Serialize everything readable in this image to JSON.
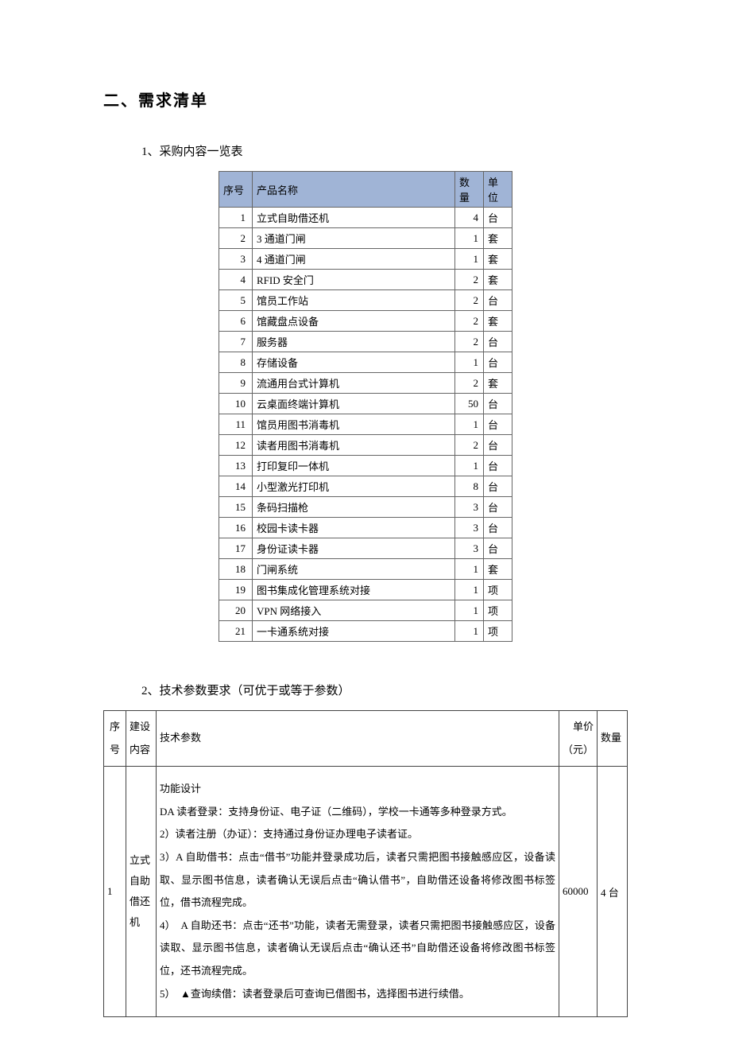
{
  "section_title": "二、需求清单",
  "subsection1_title": "1、采购内容一览表",
  "subsection2_title": "2、技术参数要求（可优于或等于参数）",
  "chart_data": {
    "type": "table",
    "columns": [
      "序号",
      "产品名称",
      "数量",
      "单位"
    ],
    "rows": [
      {
        "seq": "1",
        "name": "立式自助借还机",
        "qty": "4",
        "unit": "台"
      },
      {
        "seq": "2",
        "name": "3 通道门闸",
        "qty": "1",
        "unit": "套"
      },
      {
        "seq": "3",
        "name": "4 通道门闸",
        "qty": "1",
        "unit": "套"
      },
      {
        "seq": "4",
        "name": "RFID 安全门",
        "qty": "2",
        "unit": "套"
      },
      {
        "seq": "5",
        "name": "馆员工作站",
        "qty": "2",
        "unit": "台"
      },
      {
        "seq": "6",
        "name": "馆藏盘点设备",
        "qty": "2",
        "unit": "套"
      },
      {
        "seq": "7",
        "name": "服务器",
        "qty": "2",
        "unit": "台"
      },
      {
        "seq": "8",
        "name": "存储设备",
        "qty": "1",
        "unit": "台"
      },
      {
        "seq": "9",
        "name": "流通用台式计算机",
        "qty": "2",
        "unit": "套"
      },
      {
        "seq": "10",
        "name": "云桌面终端计算机",
        "qty": "50",
        "unit": "台"
      },
      {
        "seq": "11",
        "name": "馆员用图书消毒机",
        "qty": "1",
        "unit": "台"
      },
      {
        "seq": "12",
        "name": "读者用图书消毒机",
        "qty": "2",
        "unit": "台"
      },
      {
        "seq": "13",
        "name": "打印复印一体机",
        "qty": "1",
        "unit": "台"
      },
      {
        "seq": "14",
        "name": "小型激光打印机",
        "qty": "8",
        "unit": "台"
      },
      {
        "seq": "15",
        "name": "条码扫描枪",
        "qty": "3",
        "unit": "台"
      },
      {
        "seq": "16",
        "name": "校园卡读卡器",
        "qty": "3",
        "unit": "台"
      },
      {
        "seq": "17",
        "name": "身份证读卡器",
        "qty": "3",
        "unit": "台"
      },
      {
        "seq": "18",
        "name": "门闸系统",
        "qty": "1",
        "unit": "套"
      },
      {
        "seq": "19",
        "name": "图书集成化管理系统对接",
        "qty": "1",
        "unit": "项"
      },
      {
        "seq": "20",
        "name": "VPN 网络接入",
        "qty": "1",
        "unit": "项"
      },
      {
        "seq": "21",
        "name": "一卡通系统对接",
        "qty": "1",
        "unit": "项"
      }
    ]
  },
  "spec_table": {
    "headers": {
      "c1": "序号",
      "c2": "建设内容",
      "c3": "技术参数",
      "c4": "单价（元）",
      "c5": "数量"
    },
    "row": {
      "seq": "1",
      "item": "立式自助借还机",
      "spec": "功能设计\nDA 读者登录：支持身份证、电子证（二维码），学校一卡通等多种登录方式。\n2）读者注册（办证）：支持通过身份证办理电子读者证。\n3）A 自助借书：点击“借书”功能并登录成功后，读者只需把图书接触感应区，设备读取、显示图书信息，读者确认无误后点击“确认借书”，自助借还设备将修改图书标签位，借书流程完成。\n4）　A 自助还书：点击“还书”功能，读者无需登录，读者只需把图书接触感应区，设备读取、显示图书信息，读者确认无误后点击“确认还书”自助借还设备将修改图书标签位，还书流程完成。\n5）　▲查询续借：读者登录后可查询已借图书，选择图书进行续借。",
      "price": "60000",
      "qty": "4 台"
    }
  }
}
